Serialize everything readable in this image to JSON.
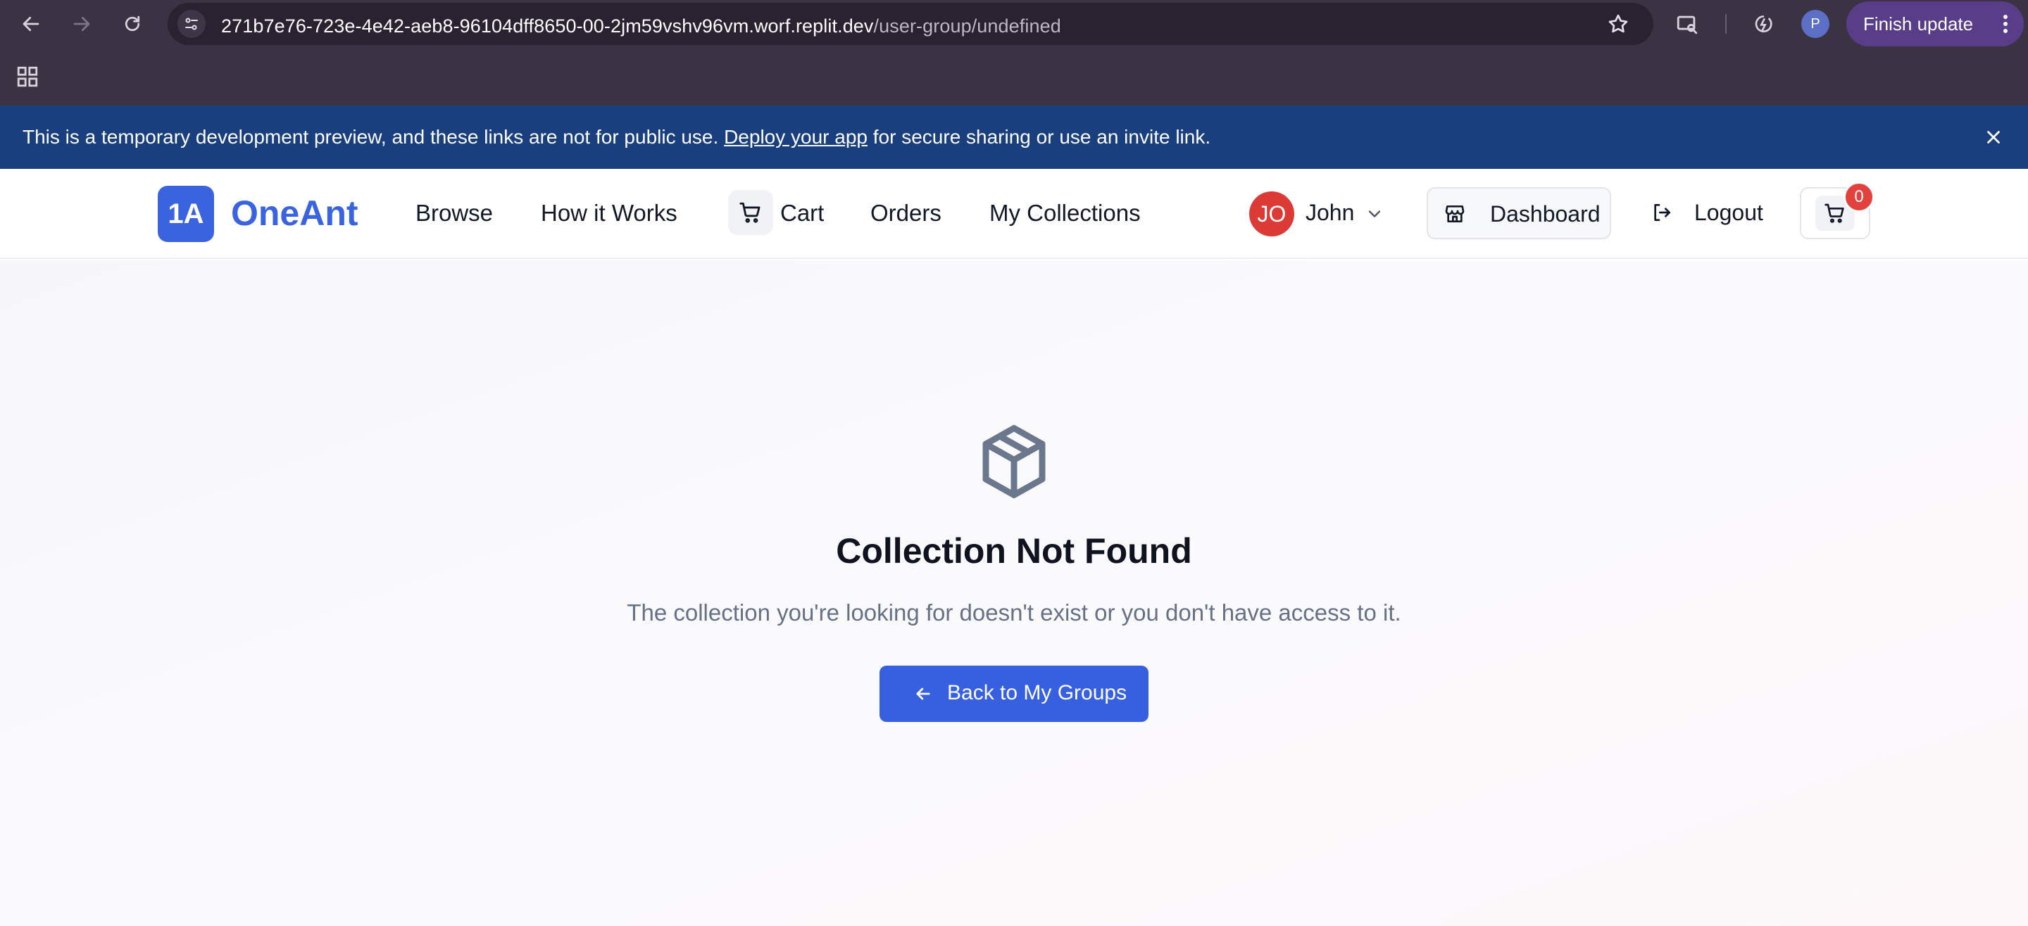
{
  "browser": {
    "url_host": "271b7e76-723e-4e42-aeb8-96104dff8650-00-2jm59vshv96vm.worf.replit.dev",
    "url_path": "/user-group/undefined",
    "profile_initial": "P",
    "finish_update_label": "Finish update"
  },
  "banner": {
    "text_before": "This is a temporary development preview, and these links are not for public use.",
    "link_text": "Deploy your app",
    "text_after": "for secure sharing or use an invite link."
  },
  "header": {
    "logo_badge": "1A",
    "logo_text": "OneAnt",
    "nav": {
      "browse": "Browse",
      "how_it_works": "How it Works",
      "cart": "Cart",
      "orders": "Orders",
      "my_collections": "My Collections"
    },
    "user": {
      "initials": "JO",
      "name": "John"
    },
    "dashboard_label": "Dashboard",
    "logout_label": "Logout",
    "cart_count": "0"
  },
  "main": {
    "title": "Collection Not Found",
    "description": "The collection you're looking for doesn't exist or you don't have access to it.",
    "back_button": "Back to My Groups"
  },
  "colors": {
    "brand": "#3a63e0",
    "banner": "#1a3f7e",
    "avatar": "#dc3b35",
    "badge": "#e2413d",
    "chrome": "#3b3243"
  }
}
